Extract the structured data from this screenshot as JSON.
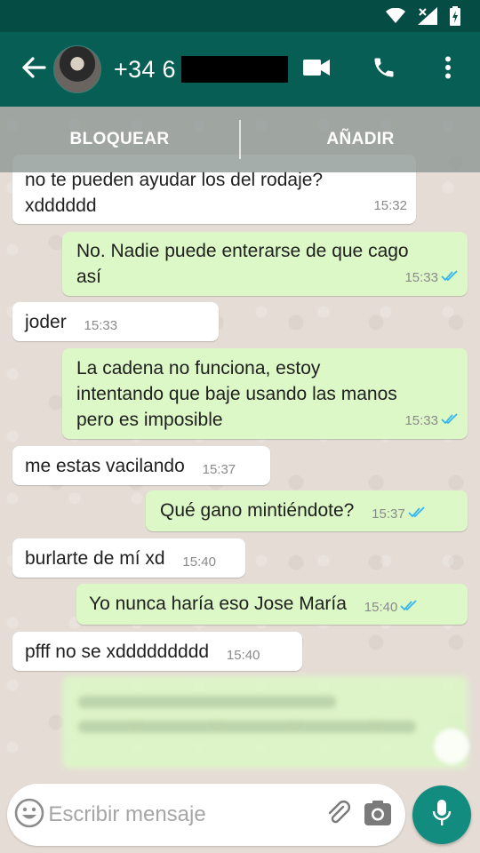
{
  "header": {
    "contact_name": "+34 6",
    "back_icon": "arrow-back-icon",
    "video_icon": "videocam-icon",
    "call_icon": "phone-icon",
    "menu_icon": "more-vert-icon"
  },
  "banner": {
    "block_label": "BLOQUEAR",
    "add_label": "AÑADIR"
  },
  "messages": [
    {
      "direction": "in",
      "text_line1": "no te pueden ayudar los del rodaje?",
      "text_line2": "xdddddd",
      "time": "15:32"
    },
    {
      "direction": "out",
      "text_line1": "No. Nadie puede enterarse de que cago",
      "text_line2": "así",
      "time": "15:33",
      "status": "read"
    },
    {
      "direction": "in",
      "text": "joder",
      "time": "15:33"
    },
    {
      "direction": "out",
      "text_line1": "La cadena no funciona, estoy",
      "text_line2": "intentando que baje usando las manos",
      "text_line3": "pero es imposible",
      "time": "15:33",
      "status": "read"
    },
    {
      "direction": "in",
      "text": "me estas vacilando",
      "time": "15:37"
    },
    {
      "direction": "out",
      "text": "Qué gano mintiéndote?",
      "time": "15:37",
      "status": "read"
    },
    {
      "direction": "in",
      "text": "burlarte de mí xd",
      "time": "15:40"
    },
    {
      "direction": "out",
      "text": "Yo nunca haría eso Jose María",
      "time": "15:40",
      "status": "read"
    },
    {
      "direction": "in",
      "text": "pfff no se xddddddddd",
      "time": "15:40"
    }
  ],
  "composer": {
    "placeholder": "Escribir mensaje",
    "emoji_icon": "emoji-icon",
    "attach_icon": "paperclip-icon",
    "camera_icon": "camera-icon",
    "mic_icon": "microphone-icon"
  },
  "colors": {
    "status_bar": "#054d44",
    "app_bar": "#075e54",
    "incoming_bubble": "#ffffff",
    "outgoing_bubble": "#dcf8c6",
    "read_ticks": "#34b7f1",
    "fab": "#128c7e"
  }
}
